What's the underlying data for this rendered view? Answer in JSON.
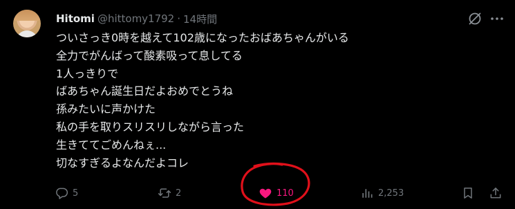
{
  "post": {
    "author_name": "Hitomi",
    "author_handle": "@hittomy1792",
    "separator": "·",
    "time": "14時間",
    "lines": [
      "ついさっき0時を越えて102歳になったおばあちゃんがいる",
      "全力でがんばって酸素吸って息してる",
      "1人っきりで",
      "ばあちゃん誕生日だよおめでとうね",
      "孫みたいに声かけた",
      "私の手を取りスリスリしながら言った",
      "生きててごめんねぇ...",
      "切なすぎるよなんだよコレ"
    ]
  },
  "actions": {
    "replies": "5",
    "reposts": "2",
    "likes": "110",
    "views": "2,253"
  },
  "icons": {
    "reply": "reply-icon",
    "repost": "repost-icon",
    "like": "heart-icon",
    "views": "views-icon",
    "bookmark": "bookmark-icon",
    "share": "share-icon",
    "grok": "grok-icon",
    "more": "more-icon"
  },
  "colors": {
    "background": "#000000",
    "text": "#e7e9ea",
    "muted": "#71767b",
    "like_active": "#f91880",
    "annotation": "#e0101a"
  }
}
